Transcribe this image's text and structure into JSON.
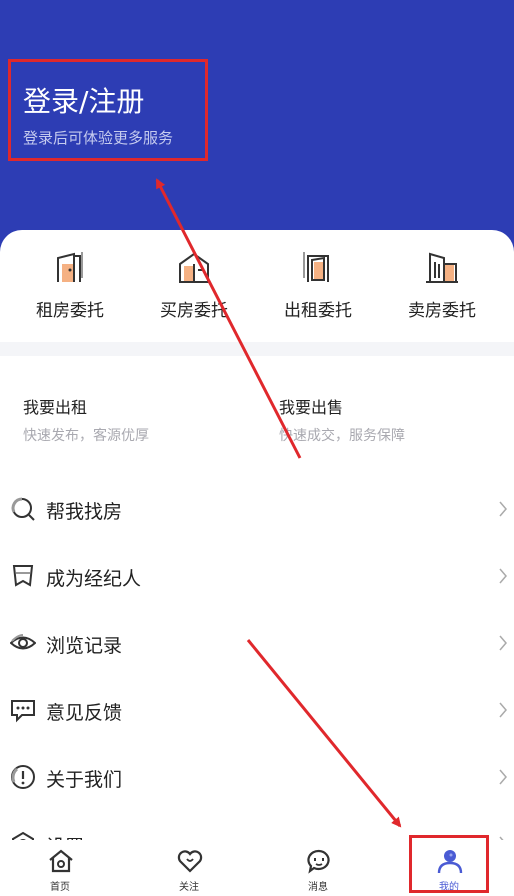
{
  "header": {
    "title": "登录/注册",
    "subtitle": "登录后可体验更多服务",
    "bg_color": "#2d3db4"
  },
  "entrust": [
    {
      "label": "租房委托",
      "icon": "door-icon"
    },
    {
      "label": "买房委托",
      "icon": "house-icon"
    },
    {
      "label": "出租委托",
      "icon": "door-open-icon"
    },
    {
      "label": "卖房委托",
      "icon": "building-icon"
    }
  ],
  "rent_sell": {
    "rent": {
      "title": "我要出租",
      "subtitle": "快速发布，客源优厚"
    },
    "sell": {
      "title": "我要出售",
      "subtitle": "快速成交，服务保障"
    }
  },
  "menu": [
    {
      "label": "帮我找房",
      "icon": "search-icon"
    },
    {
      "label": "成为经纪人",
      "icon": "badge-icon"
    },
    {
      "label": "浏览记录",
      "icon": "eye-icon"
    },
    {
      "label": "意见反馈",
      "icon": "feedback-icon"
    },
    {
      "label": "关于我们",
      "icon": "info-icon"
    },
    {
      "label": "设置",
      "icon": "settings-icon"
    }
  ],
  "tabbar": [
    {
      "label": "首页",
      "icon": "home-icon"
    },
    {
      "label": "关注",
      "icon": "heart-icon"
    },
    {
      "label": "消息",
      "icon": "message-icon"
    },
    {
      "label": "我的",
      "icon": "user-icon",
      "active": true
    }
  ],
  "colors": {
    "accent": "#4a5bd4",
    "annotation": "#e0282c",
    "icon_orange": "#f5b183"
  }
}
